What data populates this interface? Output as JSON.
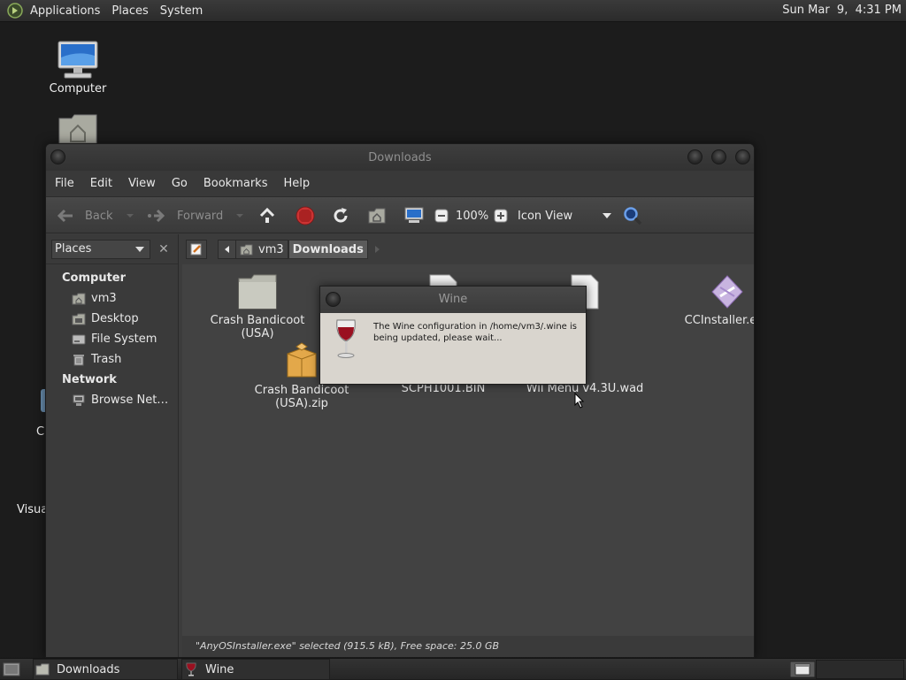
{
  "top_panel": {
    "menus": [
      "Applications",
      "Places",
      "System"
    ],
    "clock": "Sun Mar  9,  4:31 PM"
  },
  "desktop": {
    "icons": [
      {
        "label": "Computer",
        "icon": "computer-icon"
      },
      {
        "label": "",
        "icon": "home-folder-icon"
      }
    ],
    "partial_labels": [
      "C",
      "Visua"
    ]
  },
  "window": {
    "title": "Downloads",
    "menus": [
      "File",
      "Edit",
      "View",
      "Go",
      "Bookmarks",
      "Help"
    ],
    "toolbar": {
      "back": "Back",
      "forward": "Forward",
      "zoom": "100%",
      "view_mode": "Icon View"
    },
    "sidebar": {
      "selector": "Places",
      "sections": [
        {
          "title": "Computer",
          "items": [
            {
              "label": "vm3",
              "icon": "home-icon"
            },
            {
              "label": "Desktop",
              "icon": "desktop-icon"
            },
            {
              "label": "File System",
              "icon": "drive-icon"
            },
            {
              "label": "Trash",
              "icon": "trash-icon"
            }
          ]
        },
        {
          "title": "Network",
          "items": [
            {
              "label": "Browse Net…",
              "icon": "network-icon"
            }
          ]
        }
      ]
    },
    "path": [
      "vm3",
      "Downloads"
    ],
    "files": [
      {
        "name": "Crash Bandicoot (USA)",
        "icon": "folder-icon"
      },
      {
        "name": "SCPH1001.BIN",
        "icon": "file-icon"
      },
      {
        "name": "Wii Menu v4.3U.wad",
        "icon": "file-icon"
      },
      {
        "name": "CCInstaller.exe",
        "icon": "exe-icon"
      },
      {
        "name": "Crash Bandicoot (USA).zip",
        "icon": "archive-icon"
      }
    ],
    "status": "\"AnyOSInstaller.exe\" selected (915.5 kB), Free space: 25.0 GB"
  },
  "dialog": {
    "title": "Wine",
    "message": "The Wine configuration in /home/vm3/.wine is being updated, please wait..."
  },
  "taskbar": {
    "tasks": [
      {
        "label": "Downloads",
        "icon": "folder-icon"
      },
      {
        "label": "Wine",
        "icon": "wine-icon"
      }
    ]
  }
}
